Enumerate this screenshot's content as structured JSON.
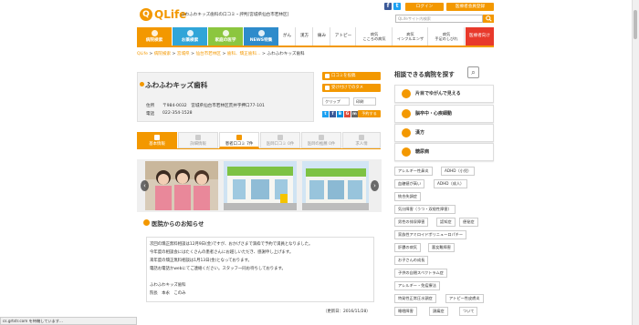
{
  "header": {
    "logo_mark": "Q",
    "logo_text": "QLife",
    "tagline": "ふわふわキッズ歯科の口コミ・評判[宮城県仙台市若林区]",
    "login_label": "ログイン",
    "member_label": "医療者会員登録",
    "search_placeholder": "QLifeサイト内検索",
    "search_icon": "magnifier-icon",
    "sns": [
      "f",
      "t"
    ]
  },
  "nav": {
    "tiles": [
      {
        "label": "病院検索",
        "color": "#f39800"
      },
      {
        "label": "お薬検索",
        "color": "#30a5d8"
      },
      {
        "label": "家庭の医学",
        "color": "#8cc63f"
      },
      {
        "label": "NEWS特集",
        "color": "#2e8bcb"
      }
    ],
    "small": [
      "がん",
      "漢方",
      "痛み",
      "アトピー"
    ],
    "two_line": [
      [
        "病気",
        "こころの病気"
      ],
      [
        "病気",
        "インフルエンザ"
      ],
      [
        "病気",
        "手足のしびれ"
      ]
    ],
    "medical": "医療者向け"
  },
  "breadcrumb": [
    "QLife",
    "病院検索",
    "宮城県",
    "仙台市若林区",
    "歯科、矯正歯科…",
    "ふわふわキッズ歯科"
  ],
  "clinic": {
    "name": "ふわふわキッズ歯科",
    "address_label": "住所",
    "address": "〒984-0032　宮城県仙台市若林区荒井字押口77-101",
    "phone_label": "電話",
    "phone": "022-354-1528",
    "btn_review": "口コミを投稿",
    "btn_appeal": "受け付けでのタメ",
    "btn_clip": "クリップ",
    "btn_print": "印刷",
    "share_icons": [
      "t",
      "f",
      "B",
      "G",
      "m"
    ],
    "plan_label": "予約する"
  },
  "tabs": [
    {
      "label": "基本情報",
      "state": "active"
    },
    {
      "label": "詳細情報",
      "state": "normal"
    },
    {
      "label": "患者口コミ 7件",
      "state": "current"
    },
    {
      "label": "医師口コミ 0件",
      "state": "normal"
    },
    {
      "label": "医師の推薦 0件",
      "state": "normal"
    },
    {
      "label": "求人情",
      "state": "normal"
    }
  ],
  "photos": {
    "prev_icon": "chevron-left-icon",
    "next_icon": "chevron-right-icon"
  },
  "notice": {
    "title": "医院からのお知らせ",
    "lines": [
      "次回の矯正無料相談は12月9日(金)ですが、おかげさまで満枠で予約で満員となりました。",
      "今年度の相談会にはたくさんの患者さんにお越しいただき、感謝申し上げます。",
      "来年度の矯正無料相談は1月13日(金)となっております。",
      "電話お電話かwebにてご連絡ください。スタッフ一同お待ちしております。",
      "",
      "ふわふわキッズ歯科",
      "院長　本永　このみ"
    ],
    "updated": "（更新日：2016/11/28）"
  },
  "right": {
    "title": "相談できる病院を探す",
    "categories": [
      "片目でゆがんで見える",
      "脳卒中・心疾細動",
      "漢方",
      "糖尿病"
    ],
    "tags": [
      [
        "アレルギー性鼻炎",
        "ADHD（小児）"
      ],
      [
        "血糖値が高い",
        "ADHD（成人）"
      ],
      [
        "統合失調症"
      ],
      [
        "気分障害（うつ・双極性障害）"
      ],
      [
        "男性の排尿障害",
        "認知症",
        "便秘症"
      ],
      [
        "家族性アミロイドポリニューロパチー"
      ],
      [
        "肝膿の病気",
        "悪女難障害"
      ],
      [
        "お子さんの成長"
      ],
      [
        "子供の自閉スペクトラム症"
      ],
      [
        "アレルギー・免疫療法"
      ],
      [
        "特発性正常圧水頭症",
        "アトピー性皮膚炎"
      ],
      [
        "睡眠障害",
        "頭痛症",
        "ついて"
      ]
    ]
  },
  "status_text": "cs.grtstr.com を待機しています..."
}
